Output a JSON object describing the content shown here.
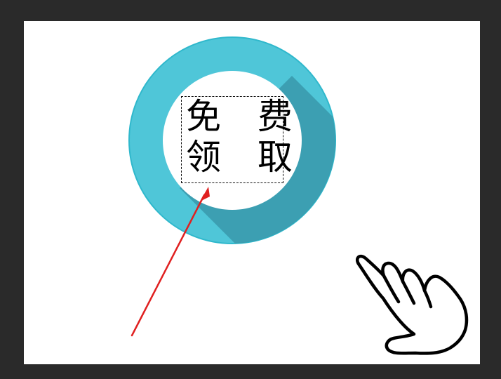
{
  "editor": {
    "canvas_background": "#ffffff",
    "workspace_background": "#2a2a2a",
    "selected_layer": "text"
  },
  "badge": {
    "line_1": "免 费",
    "line_2": "领 取",
    "ring_color": "#4ec8d9",
    "ring_edge_color": "#2fb8cc",
    "shadow_color": "#3a9aac"
  },
  "annotation": {
    "arrow_color": "#e02020",
    "target": "text-frame"
  },
  "cursor": {
    "icon": "hand-pointer-icon"
  }
}
